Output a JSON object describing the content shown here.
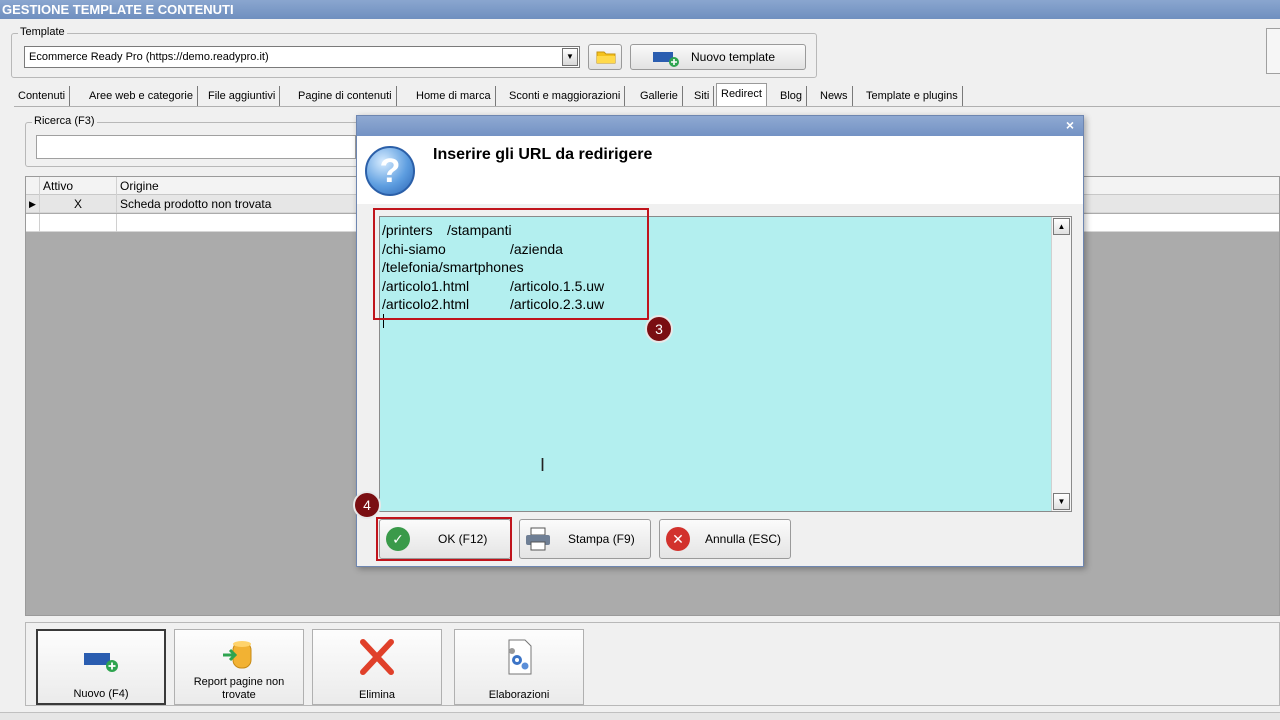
{
  "window": {
    "title": "GESTIONE TEMPLATE E CONTENUTI"
  },
  "template_group": {
    "label": "Template",
    "selected": "Ecommerce Ready Pro (https://demo.readypro.it)",
    "new_button": "Nuovo template"
  },
  "tabs": [
    "Contenuti",
    "Aree web e categorie",
    "File aggiuntivi",
    "Pagine di contenuti",
    "Home di marca",
    "Sconti e maggiorazioni",
    "Gallerie",
    "Siti",
    "Redirect",
    "Blog",
    "News",
    "Template e plugins"
  ],
  "active_tab": "Redirect",
  "search": {
    "label": "Ricerca (F3)",
    "value": ""
  },
  "grid": {
    "columns": [
      "Attivo",
      "Origine"
    ],
    "rows": [
      {
        "attivo": "X",
        "origine": "Scheda prodotto non trovata"
      }
    ]
  },
  "toolbar": {
    "new": "Nuovo (F4)",
    "report": "Report pagine non trovate",
    "delete": "Elimina",
    "process": "Elaborazioni"
  },
  "dialog": {
    "title": "Inserire gli URL da redirigere",
    "close_glyph": "×",
    "lines": [
      {
        "from": "/printers",
        "to": "/stampanti"
      },
      {
        "from": "/chi-siamo",
        "to": "/azienda"
      },
      {
        "from": "/telefonia/smartphones",
        "to": ""
      },
      {
        "from": "/articolo1.html",
        "to": "/articolo.1.5.uw"
      },
      {
        "from": "/articolo2.html",
        "to": "/articolo.2.3.uw"
      }
    ],
    "ok_button": "OK (F12)",
    "print_button": "Stampa (F9)",
    "cancel_button": "Annulla (ESC)"
  },
  "annotations": {
    "step3": "3",
    "step4": "4"
  },
  "colors": {
    "textarea_bg": "#b3efef",
    "callout": "#c0141c",
    "badge": "#7a0e12",
    "titlebar": "#7392c4"
  },
  "icons": [
    "question-icon",
    "check-icon",
    "printer-icon",
    "cancel-icon",
    "folder-icon",
    "add-template-icon",
    "add-icon",
    "report-icon",
    "delete-icon",
    "settings-icon"
  ]
}
